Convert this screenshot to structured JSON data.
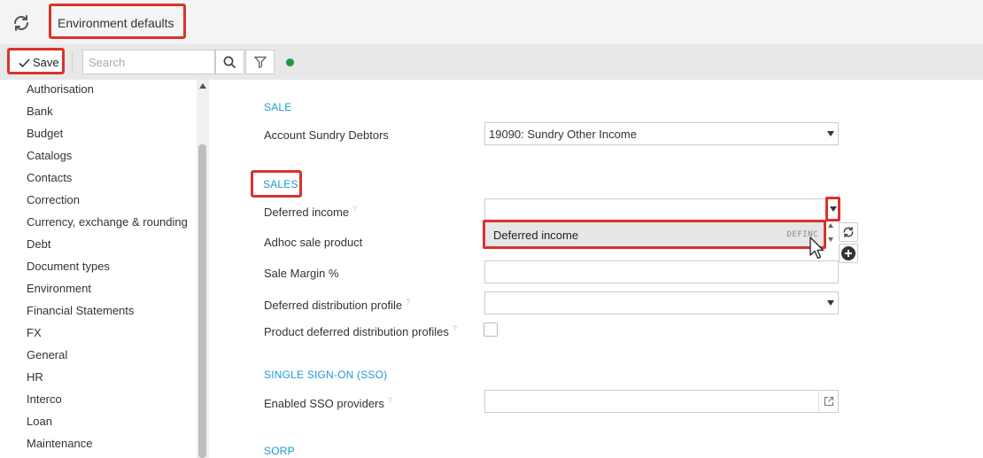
{
  "header": {
    "title": "Environment defaults"
  },
  "toolbar": {
    "save_label": "Save",
    "search_placeholder": "Search",
    "status_color": "#1a9c3c"
  },
  "sidebar": {
    "items": [
      "Authorisation",
      "Bank",
      "Budget",
      "Catalogs",
      "Contacts",
      "Correction",
      "Currency, exchange & rounding",
      "Debt",
      "Document types",
      "Environment",
      "Financial Statements",
      "FX",
      "General",
      "HR",
      "Interco",
      "Loan",
      "Maintenance"
    ]
  },
  "form": {
    "sale": {
      "heading": "SALE",
      "account_sundry_debtors": {
        "label": "Account Sundry Debtors",
        "value": "19090: Sundry Other Income"
      }
    },
    "sales": {
      "heading": "SALES",
      "deferred_income": {
        "label": "Deferred income",
        "value": ""
      },
      "adhoc_sale_product": {
        "label": "Adhoc sale product"
      },
      "sale_margin": {
        "label": "Sale Margin %",
        "value": ""
      },
      "deferred_distribution_profile": {
        "label": "Deferred distribution profile",
        "value": ""
      },
      "product_deferred_distribution_profiles": {
        "label": "Product deferred distribution profiles",
        "checked": false
      }
    },
    "dropdown_option": {
      "label": "Deferred income",
      "code": "DEFINC"
    },
    "sso": {
      "heading": "SINGLE SIGN-ON (SSO)",
      "enabled_sso_providers": {
        "label": "Enabled SSO providers",
        "value": ""
      }
    },
    "sorp": {
      "heading": "SORP"
    },
    "help_mark": "?"
  },
  "colors": {
    "accent": "#1e9ad6",
    "highlight": "#d9332b"
  }
}
